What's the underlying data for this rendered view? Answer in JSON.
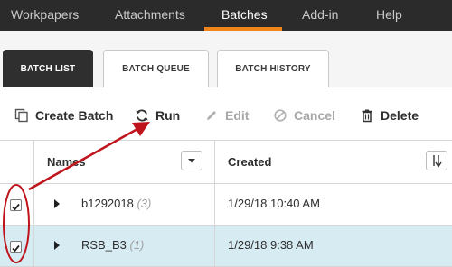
{
  "topnav": {
    "tabs": [
      {
        "label": "Workpapers"
      },
      {
        "label": "Attachments"
      },
      {
        "label": "Batches",
        "active": true
      },
      {
        "label": "Add-in"
      },
      {
        "label": "Help"
      }
    ],
    "accent_color": "#f0851c"
  },
  "subtabs": [
    {
      "label": "BATCH LIST",
      "active": true
    },
    {
      "label": "BATCH QUEUE"
    },
    {
      "label": "BATCH HISTORY"
    }
  ],
  "toolbar": {
    "create_batch": {
      "label": "Create Batch",
      "icon": "copy-icon"
    },
    "run": {
      "label": "Run",
      "icon": "refresh-icon"
    },
    "edit": {
      "label": "Edit",
      "icon": "pencil-icon",
      "disabled": true
    },
    "cancel": {
      "label": "Cancel",
      "icon": "cancel-icon",
      "disabled": true
    },
    "delete": {
      "label": "Delete",
      "icon": "trash-icon"
    }
  },
  "table": {
    "columns": [
      {
        "label": "Names",
        "icon": "chevron-down-icon"
      },
      {
        "label": "Created",
        "icon": "sort-descending-icon"
      }
    ],
    "rows": [
      {
        "name": "b1292018",
        "count": "(3)",
        "created": "1/29/18 10:40 AM",
        "checked": true,
        "selected": false
      },
      {
        "name": "RSB_B3",
        "count": "(1)",
        "created": "1/29/18 9:38 AM",
        "checked": true,
        "selected": true
      }
    ]
  },
  "annotations": {
    "arrow_color": "#c0141c",
    "oval_color": "#c0141c"
  }
}
